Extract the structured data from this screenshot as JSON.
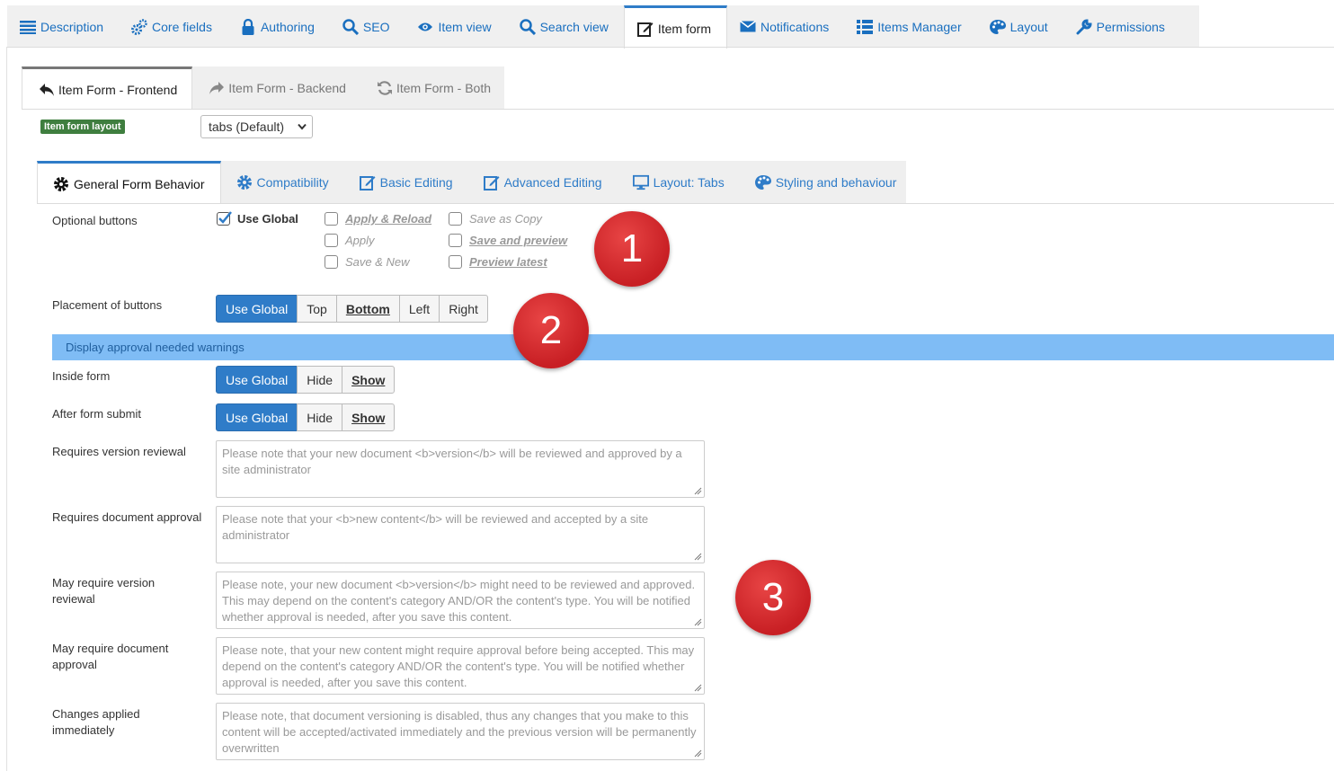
{
  "top_tabs": [
    {
      "label": "Description",
      "icon": "list-icon"
    },
    {
      "label": "Core fields",
      "icon": "cogs-icon"
    },
    {
      "label": "Authoring",
      "icon": "lock-icon"
    },
    {
      "label": "SEO",
      "icon": "search-icon"
    },
    {
      "label": "Item view",
      "icon": "eye-icon"
    },
    {
      "label": "Search view",
      "icon": "search-icon"
    },
    {
      "label": "Item form",
      "icon": "edit-icon"
    },
    {
      "label": "Notifications",
      "icon": "envelope-icon"
    },
    {
      "label": "Items Manager",
      "icon": "list-icon"
    },
    {
      "label": "Layout",
      "icon": "palette-icon"
    },
    {
      "label": "Permissions",
      "icon": "wrench-icon"
    }
  ],
  "sub_tabs": [
    {
      "label": "Item Form - Frontend",
      "icon": "reply-icon"
    },
    {
      "label": "Item Form - Backend",
      "icon": "share-icon"
    },
    {
      "label": "Item Form - Both",
      "icon": "refresh-icon"
    }
  ],
  "layout_label": "Item form layout",
  "layout_select": "tabs (Default)",
  "inner_tabs": [
    {
      "label": "General Form Behavior",
      "icon": "gear-icon"
    },
    {
      "label": "Compatibility",
      "icon": "gear-icon"
    },
    {
      "label": "Basic Editing",
      "icon": "edit-icon"
    },
    {
      "label": "Advanced Editing",
      "icon": "edit-icon"
    },
    {
      "label": "Layout: Tabs",
      "icon": "monitor-icon"
    },
    {
      "label": "Styling and behaviour",
      "icon": "palette-icon"
    }
  ],
  "optional_buttons": {
    "label": "Optional buttons",
    "use_global": "Use Global",
    "apply_reload": "Apply & Reload",
    "apply": "Apply",
    "save_new": "Save & New",
    "save_copy": "Save as Copy",
    "save_preview": "Save and preview",
    "preview_latest": "Preview latest"
  },
  "placement": {
    "label": "Placement of buttons",
    "options": [
      "Use Global",
      "Top",
      "Bottom",
      "Left",
      "Right"
    ]
  },
  "section_title": "Display approval needed warnings",
  "inside_form": {
    "label": "Inside form",
    "options": [
      "Use Global",
      "Hide",
      "Show"
    ]
  },
  "after_submit": {
    "label": "After form submit",
    "options": [
      "Use Global",
      "Hide",
      "Show"
    ]
  },
  "textareas": [
    {
      "label": "Requires version reviewal",
      "placeholder": "Please note that your new document <b>version</b> will be reviewed and approved by a site administrator"
    },
    {
      "label": "Requires document approval",
      "placeholder": "Please note that your <b>new content</b> will be reviewed and accepted by a site administrator"
    },
    {
      "label": "May require version reviewal",
      "placeholder": "Please note, your new document <b>version</b> might need to be reviewed and approved. This may depend on the content's category AND/OR the content's type. You will be notified whether approval is needed, after you save this content."
    },
    {
      "label": "May require document approval",
      "placeholder": "Please note, that your new content might require approval before being accepted. This may depend on the content's category AND/OR the content's type. You will be notified whether approval is needed, after you save this content."
    },
    {
      "label": "Changes applied immediately",
      "placeholder": "Please note, that document versioning is disabled, thus any changes that you make to this content will be accepted/activated immediately and the previous version will be permanently overwritten"
    }
  ],
  "badges": [
    "1",
    "2",
    "3"
  ]
}
